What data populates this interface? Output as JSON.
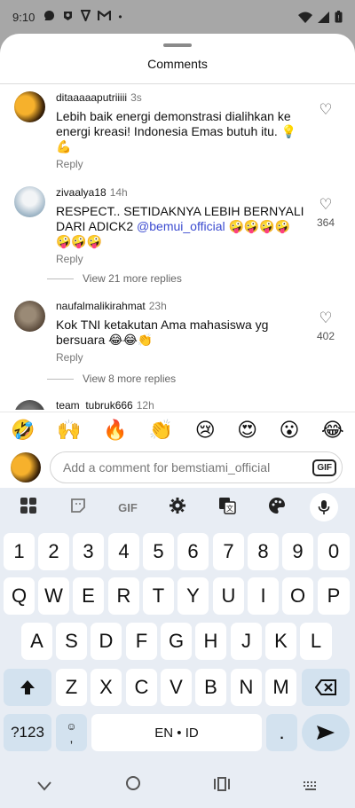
{
  "status_bar": {
    "time": "9:10",
    "notification_icons": [
      "app-icon-1",
      "app-icon-2",
      "app-icon-3",
      "gmail-icon"
    ],
    "dot": "•"
  },
  "sheet": {
    "title": "Comments"
  },
  "comments": [
    {
      "username": "ditaaaaaputriiiii",
      "time": "3s",
      "text": "Lebih baik energi demonstrasi dialihkan ke energi kreasi! Indonesia Emas butuh itu. 💡💪",
      "reply": "Reply",
      "likes": ""
    },
    {
      "username": "zivaalya18",
      "time": "14h",
      "text_before": "RESPECT.. SETIDAKNYA LEBIH BERNYALI DARI ADICK2 ",
      "mention": "@bemui_official",
      "text_after": " 🤪🤪🤪🤪🤪🤪🤪",
      "reply": "Reply",
      "likes": "364",
      "view_more": "View 21 more replies"
    },
    {
      "username": "naufalmalikirahmat",
      "time": "23h",
      "text": "Kok TNI ketakutan Ama mahasiswa yg bersuara 😂😂👏",
      "reply": "Reply",
      "likes": "402",
      "view_more": "View 8 more replies"
    },
    {
      "username": "team_tubruk666",
      "time": "12h"
    }
  ],
  "emoji_bar": [
    "🤣",
    "🙌",
    "🔥",
    "👏",
    "😢",
    "😍",
    "😮",
    "😂"
  ],
  "composer": {
    "placeholder": "Add a comment for bemstiami_official",
    "gif_label": "GIF"
  },
  "keyboard": {
    "toolbar": {
      "gif_label": "GIF"
    },
    "row_numbers": [
      "1",
      "2",
      "3",
      "4",
      "5",
      "6",
      "7",
      "8",
      "9",
      "0"
    ],
    "row_1": [
      "Q",
      "W",
      "E",
      "R",
      "T",
      "Y",
      "U",
      "I",
      "O",
      "P"
    ],
    "row_2": [
      "A",
      "S",
      "D",
      "F",
      "G",
      "H",
      "J",
      "K",
      "L"
    ],
    "row_3": [
      "Z",
      "X",
      "C",
      "V",
      "B",
      "N",
      "M"
    ],
    "symbols_label": "?123",
    "space_label": "EN • ID",
    "comma_label": ",",
    "period_label": "."
  }
}
